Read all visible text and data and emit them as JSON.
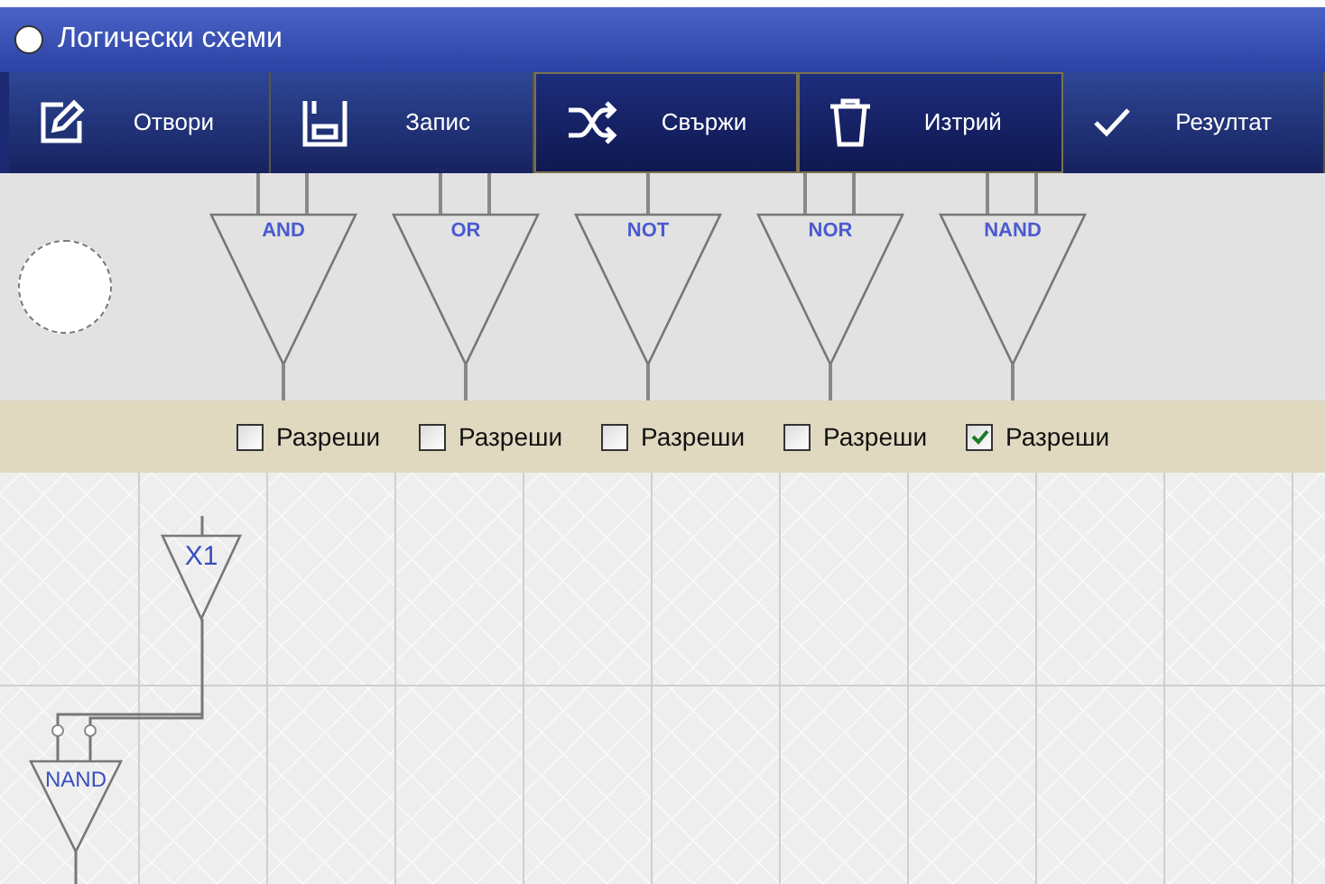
{
  "window": {
    "title": "Логически схеми"
  },
  "toolbar": [
    {
      "kind": "open",
      "label": "Отвори",
      "selected": false
    },
    {
      "kind": "save",
      "label": "Запис",
      "selected": false
    },
    {
      "kind": "connect",
      "label": "Свържи",
      "selected": true
    },
    {
      "kind": "delete",
      "label": "Изтрий",
      "selected": true
    },
    {
      "kind": "result",
      "label": "Резултат",
      "selected": false
    }
  ],
  "palette": [
    {
      "label": "AND",
      "kind": "binary",
      "enable": {
        "label": "Разреши",
        "checked": false
      }
    },
    {
      "label": "OR",
      "kind": "binary",
      "enable": {
        "label": "Разреши",
        "checked": false
      }
    },
    {
      "label": "NOT",
      "kind": "unary",
      "enable": {
        "label": "Разреши",
        "checked": false
      }
    },
    {
      "label": "NOR",
      "kind": "binary",
      "enable": {
        "label": "Разреши",
        "checked": false
      }
    },
    {
      "label": "NAND",
      "kind": "binary",
      "enable": {
        "label": "Разреши",
        "checked": true
      }
    }
  ],
  "canvas": {
    "gates": [
      {
        "label": "X1",
        "kind": "input"
      },
      {
        "label": "NAND",
        "kind": "gate"
      }
    ]
  }
}
